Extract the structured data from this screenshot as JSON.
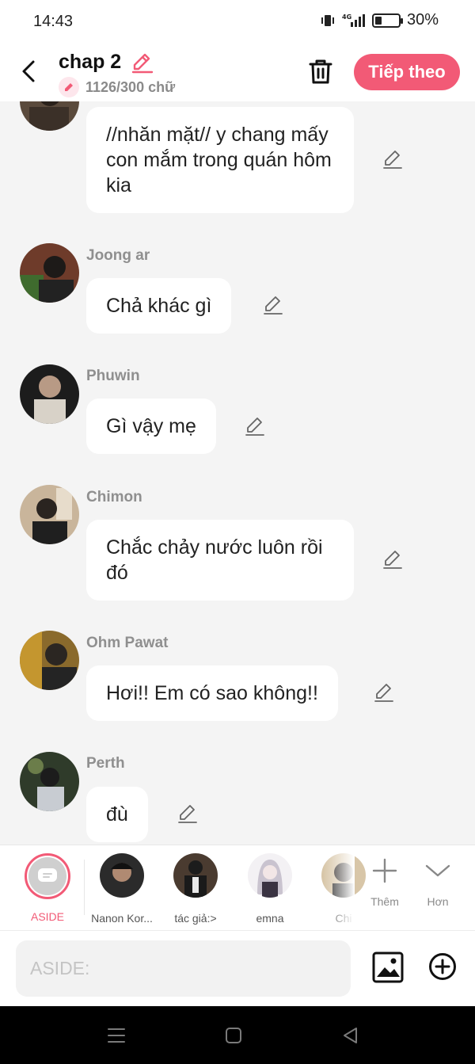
{
  "status_bar": {
    "time": "14:43",
    "network": "4G",
    "battery": "30%",
    "battery_level": 0.3
  },
  "header": {
    "back_icon": "chevron-left-icon",
    "title": "chap 2",
    "word_count": "1126/300 chữ",
    "next_label": "Tiếp theo",
    "accent_color": "#f25a76"
  },
  "messages": [
    {
      "speaker": "",
      "text": "//nhăn mặt// y chang mấy con mắm trong quán hôm kia"
    },
    {
      "speaker": "Joong ar",
      "text": "Chả khác gì"
    },
    {
      "speaker": "Phuwin",
      "text": "Gì vậy mẹ"
    },
    {
      "speaker": "Chimon",
      "text": "Chắc chảy nước luôn rồi đó"
    },
    {
      "speaker": "Ohm Pawat",
      "text": "Hơi!! Em có sao không!!"
    },
    {
      "speaker": "Perth",
      "text": "đù"
    }
  ],
  "characters": [
    {
      "name": "ASIDE",
      "selected": true
    },
    {
      "name": "Nanon Kor..."
    },
    {
      "name": "tác giả:>"
    },
    {
      "name": "emna"
    },
    {
      "name": "Chi"
    }
  ],
  "tools": {
    "add_label": "Thêm",
    "more_label": "Hơn"
  },
  "input": {
    "placeholder": "ASIDE:"
  }
}
